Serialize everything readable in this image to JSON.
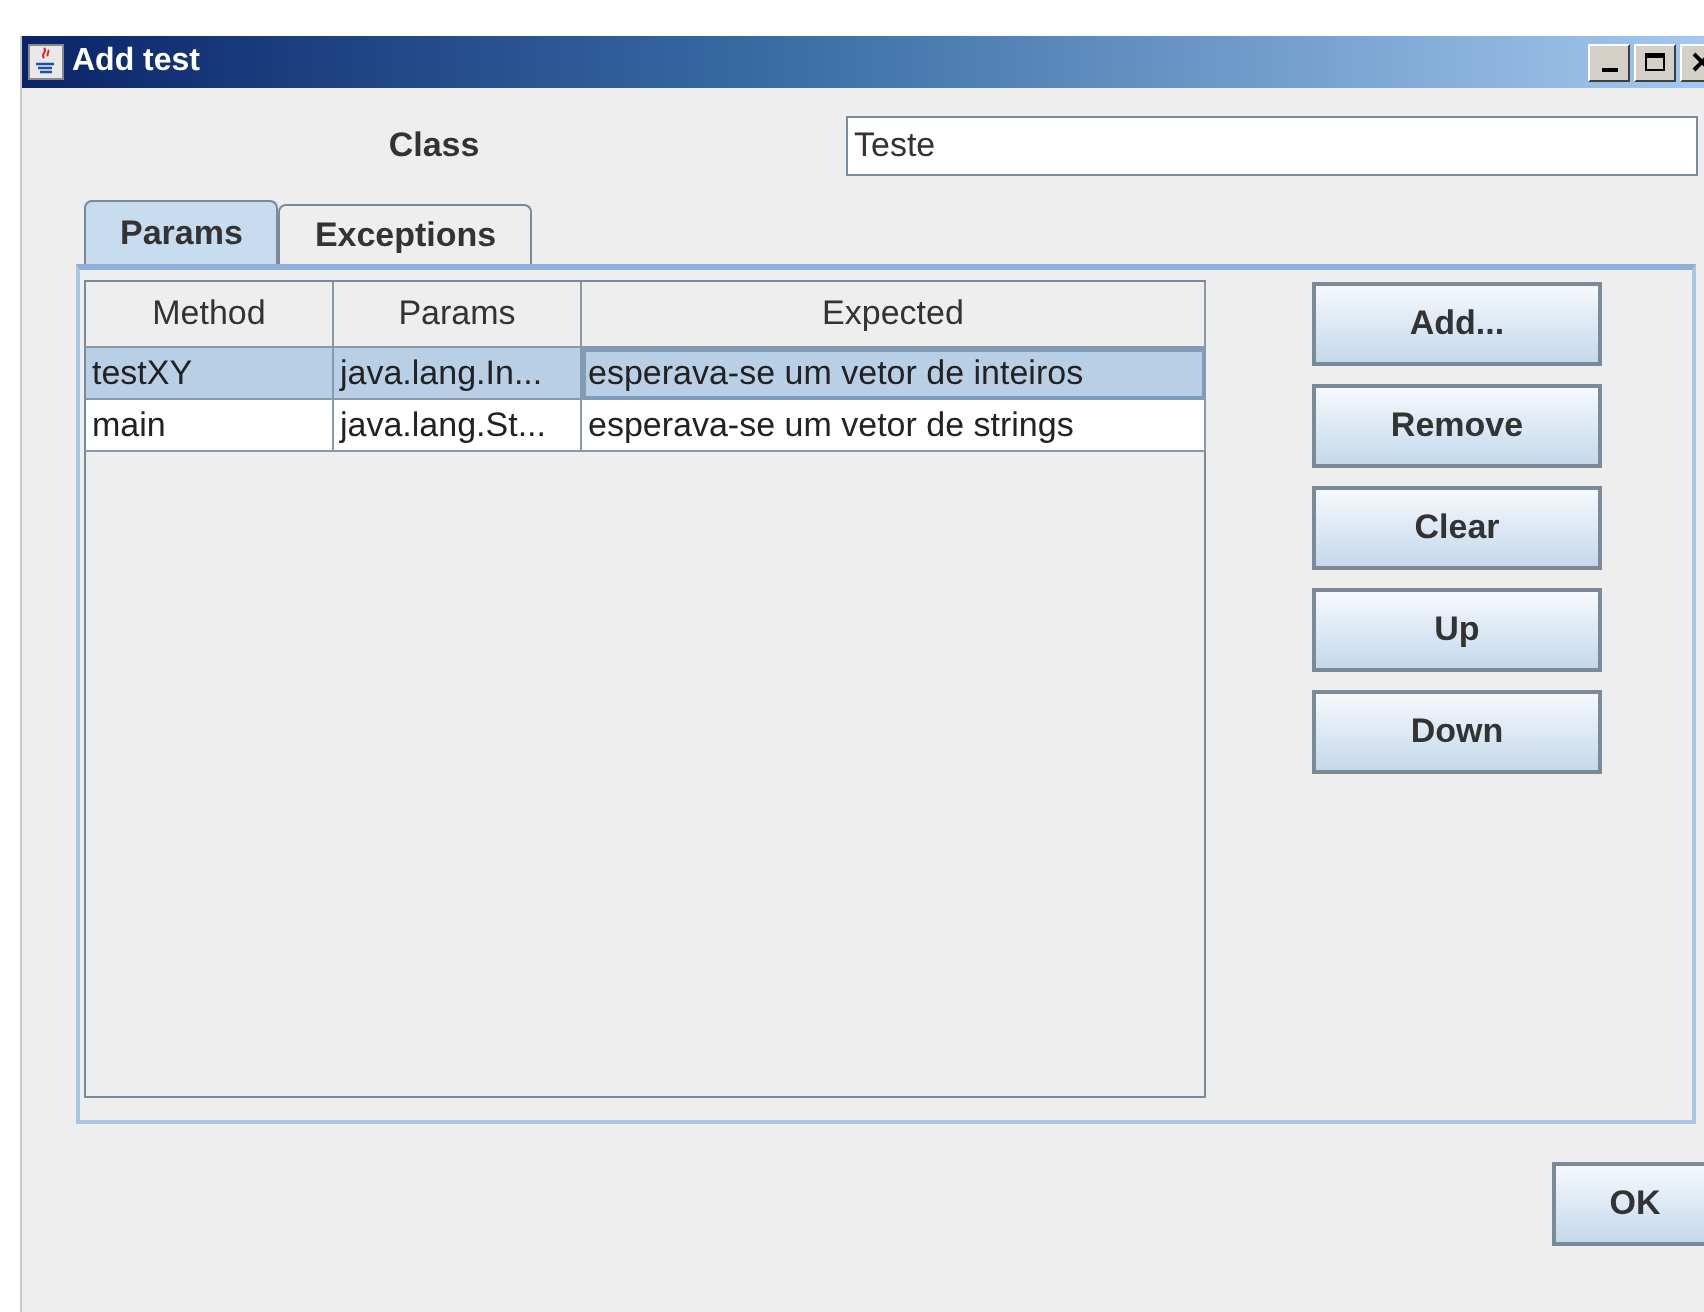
{
  "window": {
    "title": "Add test"
  },
  "class_field": {
    "label": "Class",
    "value": "Teste"
  },
  "tabs": [
    {
      "label": "Params",
      "selected": true
    },
    {
      "label": "Exceptions",
      "selected": false
    }
  ],
  "table": {
    "columns": [
      "Method",
      "Params",
      "Expected"
    ],
    "rows": [
      {
        "cells": [
          "testXY",
          "java.lang.In...",
          "esperava-se um vetor de inteiros"
        ],
        "selected": true
      },
      {
        "cells": [
          "main",
          "java.lang.St...",
          "esperava-se um vetor de strings"
        ],
        "selected": false
      }
    ]
  },
  "side_buttons": [
    "Add...",
    "Remove",
    "Clear",
    "Up",
    "Down"
  ],
  "ok_button": "OK"
}
